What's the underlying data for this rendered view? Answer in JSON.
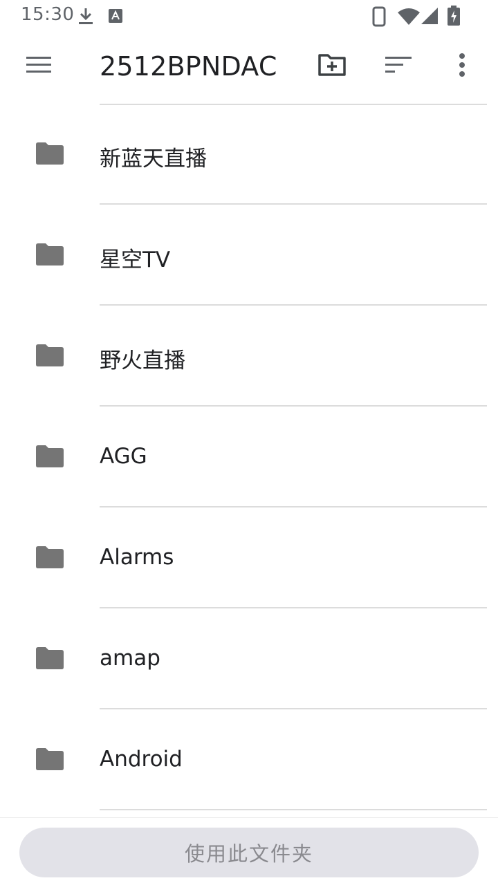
{
  "status_bar": {
    "time": "15:30",
    "icons": [
      "download-icon",
      "a-notification-icon",
      "phone-icon",
      "wifi-icon",
      "signal-icon",
      "battery-charging-icon"
    ]
  },
  "app_bar": {
    "title": "2512BPNDAC",
    "icons": [
      "menu-icon",
      "new-folder-icon",
      "sort-icon",
      "more-vert-icon"
    ]
  },
  "folders": [
    {
      "name": "新蓝天直播"
    },
    {
      "name": "星空TV"
    },
    {
      "name": "野火直播"
    },
    {
      "name": "AGG"
    },
    {
      "name": "Alarms"
    },
    {
      "name": "amap"
    },
    {
      "name": "Android"
    }
  ],
  "bottom": {
    "use_folder_label": "使用此文件夹"
  },
  "colors": {
    "icon_gray": "#5f6368",
    "folder_gray": "#757575",
    "divider": "#dcdcdc",
    "button_bg": "#e2e2e8",
    "button_text": "#8a8a8f"
  }
}
